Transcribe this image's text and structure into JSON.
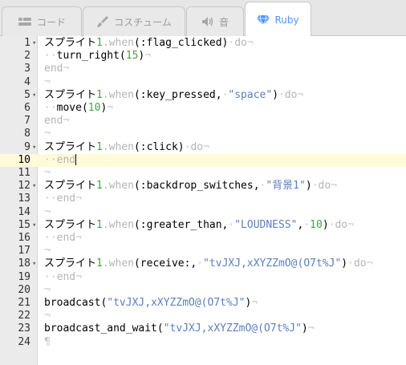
{
  "tabs": [
    {
      "label": "コード",
      "icon": "code-icon",
      "active": false
    },
    {
      "label": "コスチューム",
      "icon": "brush-icon",
      "active": false
    },
    {
      "label": "音",
      "icon": "speaker-icon",
      "active": false
    },
    {
      "label": "Ruby",
      "icon": "ruby-gem-icon",
      "active": true
    }
  ],
  "colors": {
    "accent": "#4d97ff",
    "string": "#5b7fbf",
    "number": "#4aa14a",
    "keyword": "#b4b4b4",
    "active_line": "#fffbd8"
  },
  "editor": {
    "active_line": 10,
    "lines": [
      {
        "n": "1",
        "fold": true,
        "parts": [
          [
            "t",
            "スプライト"
          ],
          [
            "num",
            "1"
          ],
          [
            "kw",
            ".when"
          ],
          [
            "t",
            "(:flag_clicked)"
          ],
          [
            "inv",
            "·"
          ],
          [
            "kw",
            "do"
          ],
          [
            "inv",
            "¬"
          ]
        ]
      },
      {
        "n": "2",
        "fold": false,
        "parts": [
          [
            "inv",
            "··"
          ],
          [
            "t",
            "turn_right("
          ],
          [
            "num",
            "15"
          ],
          [
            "t",
            ")"
          ],
          [
            "inv",
            "¬"
          ]
        ]
      },
      {
        "n": "3",
        "fold": false,
        "parts": [
          [
            "kw",
            "end"
          ],
          [
            "inv",
            "¬"
          ]
        ]
      },
      {
        "n": "4",
        "fold": false,
        "parts": [
          [
            "inv",
            "¬"
          ]
        ]
      },
      {
        "n": "5",
        "fold": true,
        "parts": [
          [
            "t",
            "スプライト"
          ],
          [
            "num",
            "1"
          ],
          [
            "kw",
            ".when"
          ],
          [
            "t",
            "(:key_pressed,"
          ],
          [
            "inv",
            "·"
          ],
          [
            "str",
            "\"space\""
          ],
          [
            "t",
            ")"
          ],
          [
            "inv",
            "·"
          ],
          [
            "kw",
            "do"
          ],
          [
            "inv",
            "¬"
          ]
        ]
      },
      {
        "n": "6",
        "fold": false,
        "parts": [
          [
            "inv",
            "··"
          ],
          [
            "t",
            "move("
          ],
          [
            "num",
            "10"
          ],
          [
            "t",
            ")"
          ],
          [
            "inv",
            "¬"
          ]
        ]
      },
      {
        "n": "7",
        "fold": false,
        "parts": [
          [
            "kw",
            "end"
          ],
          [
            "inv",
            "¬"
          ]
        ]
      },
      {
        "n": "8",
        "fold": false,
        "parts": [
          [
            "inv",
            "¬"
          ]
        ]
      },
      {
        "n": "9",
        "fold": true,
        "parts": [
          [
            "t",
            "スプライト"
          ],
          [
            "num",
            "1"
          ],
          [
            "kw",
            ".when"
          ],
          [
            "t",
            "(:click)"
          ],
          [
            "inv",
            "·"
          ],
          [
            "kw",
            "do"
          ],
          [
            "inv",
            "¬"
          ]
        ]
      },
      {
        "n": "10",
        "fold": false,
        "parts": [
          [
            "inv",
            "··"
          ],
          [
            "kw",
            "end"
          ],
          [
            "cursor",
            ""
          ]
        ]
      },
      {
        "n": "11",
        "fold": false,
        "parts": [
          [
            "inv",
            "¬"
          ]
        ]
      },
      {
        "n": "12",
        "fold": true,
        "parts": [
          [
            "t",
            "スプライト"
          ],
          [
            "num",
            "1"
          ],
          [
            "kw",
            ".when"
          ],
          [
            "t",
            "(:backdrop_switches,"
          ],
          [
            "inv",
            "·"
          ],
          [
            "str",
            "\"背景1\""
          ],
          [
            "t",
            ")"
          ],
          [
            "inv",
            "·"
          ],
          [
            "kw",
            "do"
          ],
          [
            "inv",
            "¬"
          ]
        ]
      },
      {
        "n": "13",
        "fold": false,
        "parts": [
          [
            "inv",
            "··"
          ],
          [
            "kw",
            "end"
          ],
          [
            "inv",
            "¬"
          ]
        ]
      },
      {
        "n": "14",
        "fold": false,
        "parts": [
          [
            "inv",
            "¬"
          ]
        ]
      },
      {
        "n": "15",
        "fold": true,
        "parts": [
          [
            "t",
            "スプライト"
          ],
          [
            "num",
            "1"
          ],
          [
            "kw",
            ".when"
          ],
          [
            "t",
            "(:greater_than,"
          ],
          [
            "inv",
            "·"
          ],
          [
            "str",
            "\"LOUDNESS\""
          ],
          [
            "t",
            ","
          ],
          [
            "inv",
            "·"
          ],
          [
            "num",
            "10"
          ],
          [
            "t",
            ")"
          ],
          [
            "inv",
            "·"
          ],
          [
            "kw",
            "do"
          ],
          [
            "inv",
            "¬"
          ]
        ]
      },
      {
        "n": "16",
        "fold": false,
        "parts": [
          [
            "inv",
            "··"
          ],
          [
            "kw",
            "end"
          ],
          [
            "inv",
            "¬"
          ]
        ]
      },
      {
        "n": "17",
        "fold": false,
        "parts": [
          [
            "inv",
            "¬"
          ]
        ]
      },
      {
        "n": "18",
        "fold": true,
        "parts": [
          [
            "t",
            "スプライト"
          ],
          [
            "num",
            "1"
          ],
          [
            "kw",
            ".when"
          ],
          [
            "t",
            "(receive:,"
          ],
          [
            "inv",
            "·"
          ],
          [
            "str",
            "\"tvJXJ,xXYZZmO@(O7t%J\""
          ],
          [
            "t",
            ")"
          ],
          [
            "inv",
            "·"
          ],
          [
            "kw",
            "do"
          ],
          [
            "inv",
            "¬"
          ]
        ]
      },
      {
        "n": "19",
        "fold": false,
        "parts": [
          [
            "inv",
            "··"
          ],
          [
            "kw",
            "end"
          ],
          [
            "inv",
            "¬"
          ]
        ]
      },
      {
        "n": "20",
        "fold": false,
        "parts": [
          [
            "inv",
            "¬"
          ]
        ]
      },
      {
        "n": "21",
        "fold": false,
        "parts": [
          [
            "t",
            "broadcast("
          ],
          [
            "str",
            "\"tvJXJ,xXYZZmO@(O7t%J\""
          ],
          [
            "t",
            ")"
          ],
          [
            "inv",
            "¬"
          ]
        ]
      },
      {
        "n": "22",
        "fold": false,
        "parts": [
          [
            "inv",
            "¬"
          ]
        ]
      },
      {
        "n": "23",
        "fold": false,
        "parts": [
          [
            "t",
            "broadcast_and_wait("
          ],
          [
            "str",
            "\"tvJXJ,xXYZZmO@(O7t%J\""
          ],
          [
            "t",
            ")"
          ],
          [
            "inv",
            "¬"
          ]
        ]
      },
      {
        "n": "24",
        "fold": false,
        "parts": [
          [
            "inv",
            "¶"
          ]
        ]
      }
    ]
  }
}
